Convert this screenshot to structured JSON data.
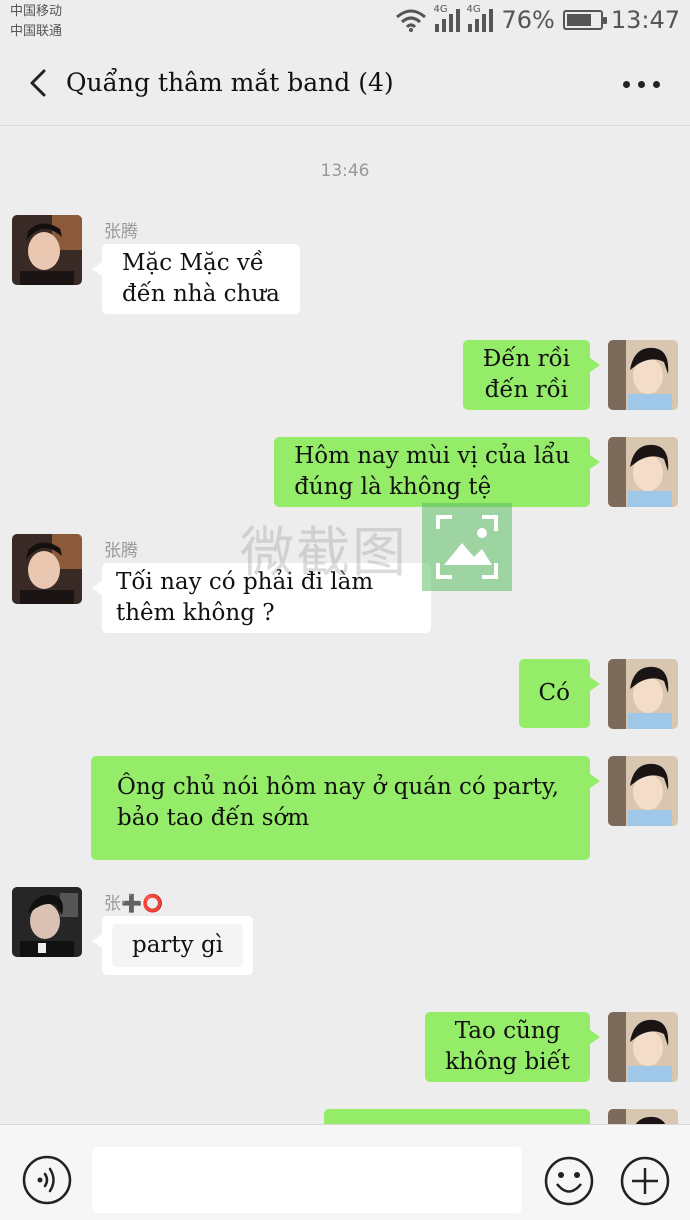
{
  "status_bar": {
    "carrier1": "中国移动",
    "carrier2": "中国联通",
    "network1": "4G",
    "network2": "4G",
    "battery": "76%",
    "battery_level": 0.76,
    "time": "13:47"
  },
  "header": {
    "title": "Quẩng thâm mắt band (4)"
  },
  "chat": {
    "timestamp": "13:46",
    "messages": [
      {
        "side": "in",
        "sender": "张腾",
        "lines": [
          "Mặc Mặc về",
          "đến nhà chưa"
        ]
      },
      {
        "side": "out",
        "lines": [
          "Đến rồi",
          "đến rồi"
        ]
      },
      {
        "side": "out",
        "lines": [
          "Hôm nay mùi vị của lẩu",
          "đúng là không tệ"
        ]
      },
      {
        "side": "in",
        "sender": "张腾",
        "lines": [
          "Tối nay có phải đi làm",
          "thêm không ?"
        ]
      },
      {
        "side": "out",
        "lines": [
          "Có"
        ]
      },
      {
        "side": "out",
        "lines": [
          "Ông chủ nói hôm nay ở quán có party,",
          "bảo tao đến sớm"
        ]
      },
      {
        "side": "in",
        "sender": "张➕⭕",
        "lines": [
          "party gì"
        ]
      },
      {
        "side": "out",
        "lines": [
          "Tao cũng",
          "không biết"
        ]
      }
    ]
  },
  "watermark": {
    "text": "微截图"
  },
  "input_bar": {
    "voice_icon": "voice-icon",
    "emoji_icon": "emoji-icon",
    "plus_icon": "plus-icon"
  },
  "colors": {
    "background": "#ededed",
    "outgoing_bubble": "#95ec69",
    "incoming_bubble": "#ffffff",
    "meta_text": "#999999"
  }
}
